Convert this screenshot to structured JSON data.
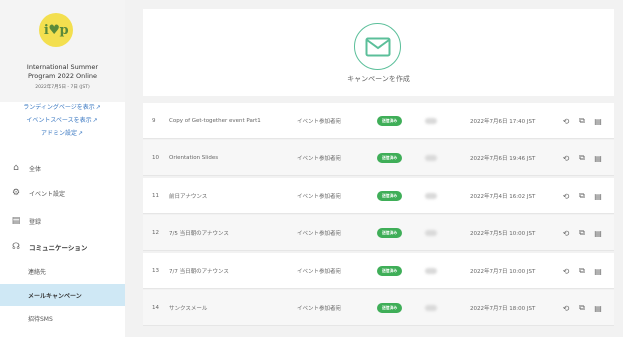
{
  "sidebar": {
    "logo_text": "i♥p",
    "event_name_line1": "International Summer",
    "event_name_line2": "Program 2022 Online",
    "event_date": "2022年7月5日 - 7日 (JST)",
    "links": [
      {
        "label": "ランディングページを表示"
      },
      {
        "label": "イベントスペースを表示"
      },
      {
        "label": "アドミン設定"
      }
    ],
    "nav": [
      {
        "label": "全体",
        "icon": "home-icon"
      },
      {
        "label": "イベント設定",
        "icon": "gear-icon"
      },
      {
        "label": "登録",
        "icon": "clipboard-icon"
      },
      {
        "label": "コミュニケーション",
        "icon": "headset-icon"
      }
    ],
    "sub_items": [
      {
        "label": "連絡先"
      },
      {
        "label": "メールキャンペーン",
        "active": true
      },
      {
        "label": "招待SMS"
      }
    ]
  },
  "header": {
    "create_label": "キャンペーンを作成"
  },
  "campaigns": [
    {
      "no": "9",
      "name": "Copy of Get-together event Part1",
      "audience": "イベント参加者宛",
      "status": "送信済み",
      "date": "2022年7月6日 17:40 JST"
    },
    {
      "no": "10",
      "name": "Orientation Slides",
      "audience": "イベント参加者宛",
      "status": "送信済み",
      "date": "2022年7月6日 19:46 JST"
    },
    {
      "no": "11",
      "name": "前日アナウンス",
      "audience": "イベント参加者宛",
      "status": "送信済み",
      "date": "2022年7月4日 16:02 JST"
    },
    {
      "no": "12",
      "name": "7/5 当日朝のアナウンス",
      "audience": "イベント参加者宛",
      "status": "送信済み",
      "date": "2022年7月5日 10:00 JST"
    },
    {
      "no": "13",
      "name": "7/7 当日朝のアナウンス",
      "audience": "イベント参加者宛",
      "status": "送信済み",
      "date": "2022年7月7日 10:00 JST"
    },
    {
      "no": "14",
      "name": "サンクスメール",
      "audience": "イベント参加者宛",
      "status": "送信済み",
      "date": "2022年7月7日 18:00 JST"
    }
  ],
  "colors": {
    "accent_green": "#3fae58",
    "mail_teal": "#5bbf9a",
    "link_blue": "#3a78c2",
    "active_bg": "#cfe8f5",
    "logo_yellow": "#f3df4f"
  }
}
